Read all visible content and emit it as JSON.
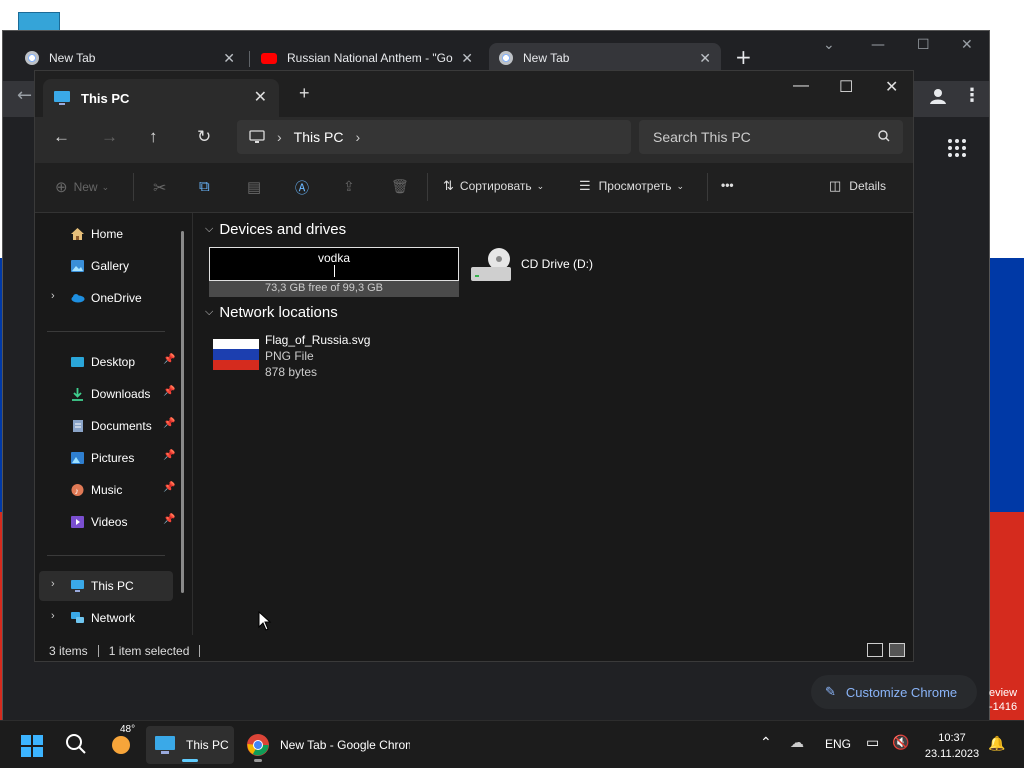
{
  "colors": {
    "flag_white": "#ffffff",
    "flag_blue": "#0039a6",
    "flag_red": "#d52b1e",
    "chrome_accent": "#8ab4f8",
    "win_accent": "#60cdff"
  },
  "chrome": {
    "tabs": [
      {
        "label": "New Tab",
        "icon": "chrome-icon"
      },
      {
        "label": "Russian National Anthem - \"Go",
        "icon": "youtube-icon"
      },
      {
        "label": "New Tab",
        "icon": "chrome-icon"
      }
    ],
    "customize_label": "Customize Chrome",
    "edge_text_1": "eview",
    "edge_text_2": "-1416"
  },
  "explorer": {
    "tab_title": "This PC",
    "address": {
      "location": "This PC"
    },
    "search_placeholder": "Search This PC",
    "commands": {
      "new": "New",
      "sort": "Сортировать",
      "view": "Просмотреть",
      "more": "•••",
      "details": "Details"
    },
    "sidebar": {
      "items": [
        {
          "label": "Home",
          "icon": "home-icon"
        },
        {
          "label": "Gallery",
          "icon": "gallery-icon"
        },
        {
          "label": "OneDrive",
          "icon": "cloud-icon"
        },
        {
          "label": "Desktop",
          "icon": "desktop-icon"
        },
        {
          "label": "Downloads",
          "icon": "download-icon"
        },
        {
          "label": "Documents",
          "icon": "document-icon"
        },
        {
          "label": "Pictures",
          "icon": "pictures-icon"
        },
        {
          "label": "Music",
          "icon": "music-icon"
        },
        {
          "label": "Videos",
          "icon": "video-icon"
        },
        {
          "label": "This PC",
          "icon": "computer-icon"
        },
        {
          "label": "Network",
          "icon": "network-icon"
        }
      ]
    },
    "groups": {
      "devices": "Devices and drives",
      "network": "Network locations"
    },
    "drive": {
      "rename_value": "vodka",
      "free_text": "73,3 GB free of 99,3 GB",
      "used_fraction": 0.262
    },
    "cd_drive": {
      "label": "CD Drive (D:)"
    },
    "net_file": {
      "name": "Flag_of_Russia.svg",
      "type": "PNG File",
      "size": "878 bytes"
    },
    "status": {
      "items": "3 items",
      "selected": "1 item selected"
    }
  },
  "taskbar": {
    "weather_temp": "48°",
    "explorer_label": "This PC",
    "chrome_label": "New Tab - Google Chrome",
    "language": "ENG",
    "time": "10:37",
    "date": "23.11.2023"
  }
}
